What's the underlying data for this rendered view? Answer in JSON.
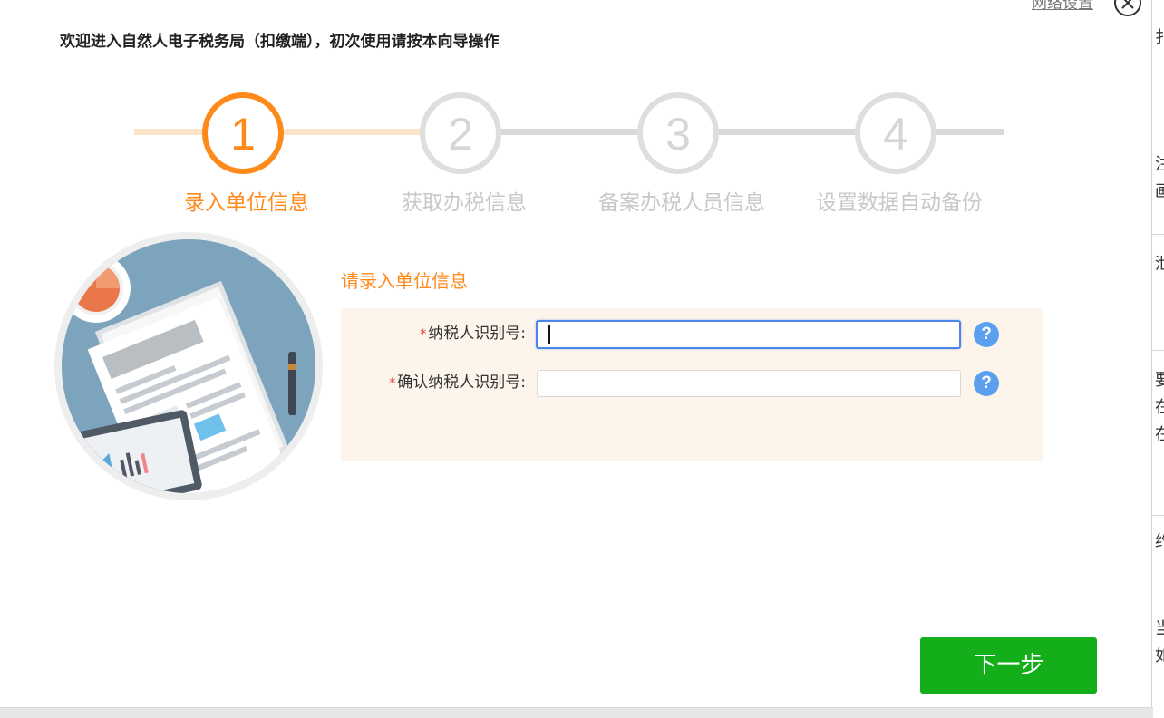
{
  "header": {
    "network_settings_label": "网络设置",
    "welcome_text": "欢迎进入自然人电子税务局（扣缴端），初次使用请按本向导操作"
  },
  "steps": [
    {
      "number": "1",
      "label": "录入单位信息",
      "state": "active"
    },
    {
      "number": "2",
      "label": "获取办税信息",
      "state": "inactive"
    },
    {
      "number": "3",
      "label": "备案办税人员信息",
      "state": "inactive"
    },
    {
      "number": "4",
      "label": "设置数据自动备份",
      "state": "inactive"
    }
  ],
  "form": {
    "title": "请录入单位信息",
    "fields": [
      {
        "required_mark": "*",
        "label": "纳税人识别号:",
        "value": "",
        "focused": true,
        "help_icon": "?"
      },
      {
        "required_mark": "*",
        "label": "确认纳税人识别号:",
        "value": "",
        "focused": false,
        "help_icon": "?"
      }
    ]
  },
  "buttons": {
    "next_label": "下一步"
  },
  "background_window": {
    "text_fragments": [
      "扌",
      "注",
      "画",
      "泄",
      "要",
      "在",
      "在",
      "约",
      "当",
      "如"
    ]
  },
  "colors": {
    "accent_orange": "#ff8a1c",
    "inactive_gray": "#dedede",
    "next_button_green": "#13ae1a",
    "help_icon_blue": "#5aa0ee",
    "panel_background": "#fdf4ec",
    "required_red": "#e8382b"
  },
  "icons": {
    "close": "close-icon",
    "help": "help-question-icon",
    "illustration": "document-report-illustration"
  }
}
